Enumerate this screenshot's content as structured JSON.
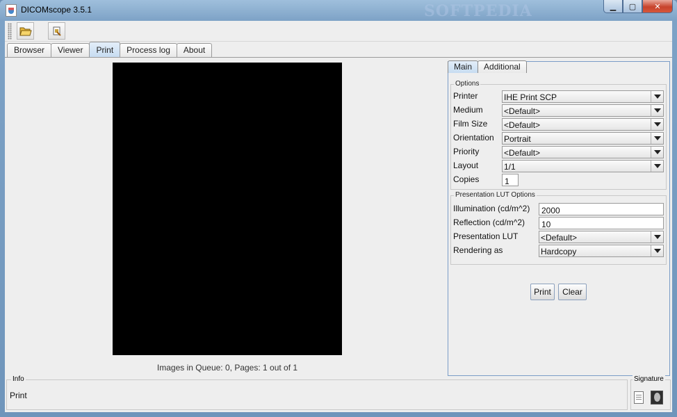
{
  "window": {
    "title": "DICOMscope 3.5.1",
    "watermark": "SOFTPEDIA",
    "min": "▁",
    "max": "▢",
    "close": "✕"
  },
  "toolbar": {
    "open_icon": "folder-open-icon",
    "print_icon": "print-queue-icon"
  },
  "tabs": [
    {
      "label": "Browser",
      "active": false
    },
    {
      "label": "Viewer",
      "active": false
    },
    {
      "label": "Print",
      "active": true
    },
    {
      "label": "Process log",
      "active": false
    },
    {
      "label": "About",
      "active": false
    }
  ],
  "preview": {
    "queue_status": "Images in Queue: 0, Pages: 1 out of 1"
  },
  "panel": {
    "subtabs": [
      {
        "label": "Main",
        "active": true
      },
      {
        "label": "Additional",
        "active": false
      }
    ],
    "options_title": "Options",
    "options": [
      {
        "label": "Printer",
        "value": "IHE Print SCP"
      },
      {
        "label": "Medium",
        "value": "<Default>"
      },
      {
        "label": "Film Size",
        "value": "<Default>"
      },
      {
        "label": "Orientation",
        "value": "Portrait"
      },
      {
        "label": "Priority",
        "value": "<Default>"
      },
      {
        "label": "Layout",
        "value": "1/1"
      }
    ],
    "copies_label": "Copies",
    "copies_value": "1",
    "lut_title": "Presentation LUT Options",
    "illumination_label": "Illumination (cd/m^2)",
    "illumination_value": "2000",
    "reflection_label": "Reflection (cd/m^2)",
    "reflection_value": "10",
    "presentation_lut_label": "Presentation LUT",
    "presentation_lut_value": "<Default>",
    "rendering_label": "Rendering as",
    "rendering_value": "Hardcopy",
    "print_button": "Print",
    "clear_button": "Clear"
  },
  "status": {
    "info_title": "Info",
    "info_text": "Print",
    "signature_title": "Signature"
  }
}
